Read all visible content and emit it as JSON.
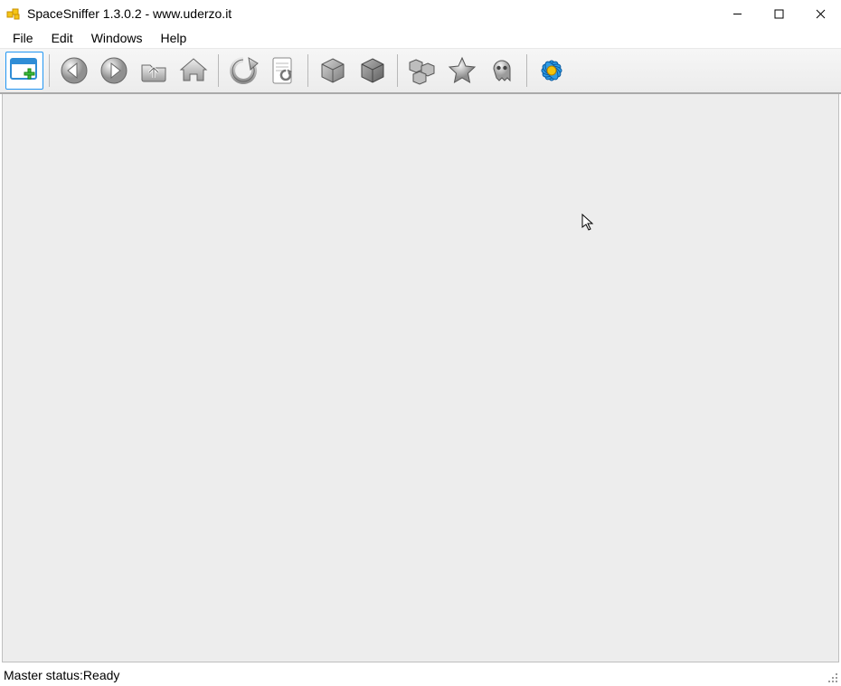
{
  "title": "SpaceSniffer 1.3.0.2 - www.uderzo.it",
  "menu": {
    "file": "File",
    "edit": "Edit",
    "windows": "Windows",
    "help": "Help"
  },
  "toolbar": {
    "new": "new-scan",
    "back": "back",
    "forward": "forward",
    "up": "folder-up",
    "home": "home",
    "refresh": "refresh",
    "refresh_page": "refresh-page",
    "box1": "zoom-less",
    "box2": "zoom-more",
    "multi": "detail-level",
    "star": "favorites",
    "ghost": "ghost-toggle",
    "flower": "settings"
  },
  "status_label": "Master status: ",
  "status_value": "Ready"
}
